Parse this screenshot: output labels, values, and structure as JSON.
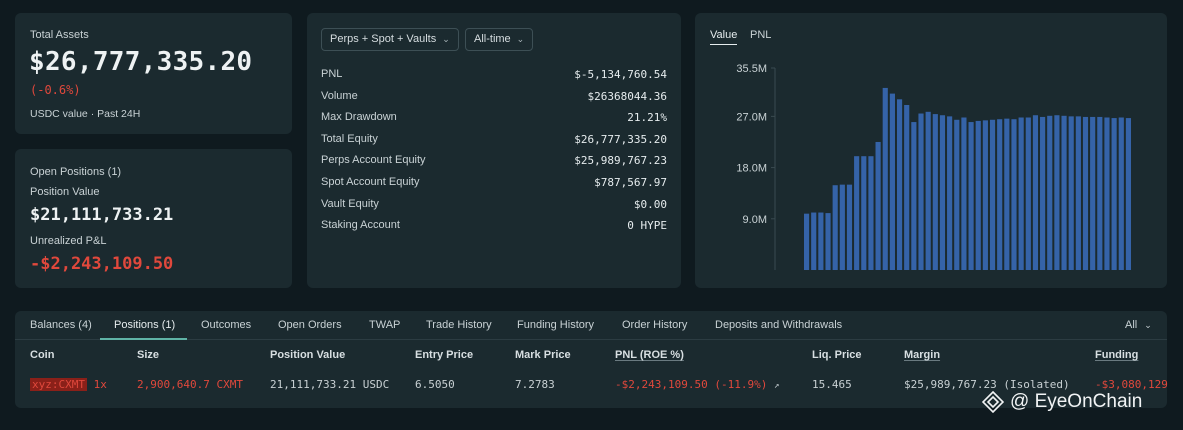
{
  "total_assets": {
    "label": "Total Assets",
    "value": "$26,777,335.20",
    "change": "(-0.6%)",
    "sub": "USDC value · Past 24H"
  },
  "open_positions": {
    "title": "Open Positions (1)",
    "position_value_label": "Position Value",
    "position_value": "$21,111,733.21",
    "upnl_label": "Unrealized P&L",
    "upnl_value": "-$2,243,109.50"
  },
  "stats": {
    "scope_dropdown": "Perps + Spot + Vaults",
    "range_dropdown": "All-time",
    "rows": [
      {
        "label": "PNL",
        "value": "$-5,134,760.54"
      },
      {
        "label": "Volume",
        "value": "$26368044.36"
      },
      {
        "label": "Max Drawdown",
        "value": "21.21%"
      },
      {
        "label": "Total Equity",
        "value": "$26,777,335.20"
      },
      {
        "label": "Perps Account Equity",
        "value": "$25,989,767.23"
      },
      {
        "label": "Spot Account Equity",
        "value": "$787,567.97"
      },
      {
        "label": "Vault Equity",
        "value": "$0.00"
      },
      {
        "label": "Staking Account",
        "value": "0 HYPE"
      }
    ]
  },
  "chart_tabs": {
    "value": "Value",
    "pnl": "PNL"
  },
  "chart_data": {
    "type": "bar",
    "title": "",
    "xlabel": "",
    "ylabel": "",
    "ylim": [
      0,
      35.5
    ],
    "yticks": [
      {
        "v": 35.5,
        "label": "35.5M"
      },
      {
        "v": 27.0,
        "label": "27.0M"
      },
      {
        "v": 18.0,
        "label": "18.0M"
      },
      {
        "v": 9.0,
        "label": "9.0M"
      }
    ],
    "values": [
      9.9,
      10.1,
      10.1,
      10.0,
      14.9,
      15.0,
      15.0,
      20.0,
      20.0,
      20.0,
      22.5,
      32.0,
      31.0,
      30.0,
      29.0,
      26.0,
      27.5,
      27.8,
      27.4,
      27.2,
      27.0,
      26.4,
      26.8,
      26.0,
      26.2,
      26.3,
      26.4,
      26.5,
      26.6,
      26.5,
      26.8,
      26.8,
      27.2,
      26.9,
      27.1,
      27.2,
      27.1,
      27.0,
      27.0,
      26.9,
      26.9,
      26.9,
      26.8,
      26.7,
      26.8,
      26.7
    ]
  },
  "table": {
    "tabs": [
      "Balances (4)",
      "Positions (1)",
      "Outcomes",
      "Open Orders",
      "TWAP",
      "Trade History",
      "Funding History",
      "Order History",
      "Deposits and Withdrawals"
    ],
    "filter": "All",
    "headers": [
      "Coin",
      "Size",
      "Position Value",
      "Entry Price",
      "Mark Price",
      "PNL (ROE %)",
      "Liq. Price",
      "Margin",
      "Funding"
    ],
    "row": {
      "coin": "xyz:CXMT",
      "leverage": "1x",
      "size": "2,900,640.7 CXMT",
      "position_value": "21,111,733.21 USDC",
      "entry_price": "6.5050",
      "mark_price": "7.2783",
      "pnl": "-$2,243,109.50 (-11.9%)",
      "liq_price": "15.465",
      "margin": "$25,989,767.23 (Isolated)",
      "funding": "-$3,080,129"
    }
  },
  "watermark": "@ EyeOnChain",
  "colors": {
    "red": "#e0483c",
    "bar": "#3563a8",
    "accent": "#5fb3a6",
    "panel": "#1b2a2f",
    "bg": "#0f1a1f"
  }
}
